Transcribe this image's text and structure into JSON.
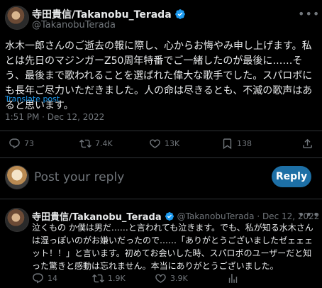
{
  "tweet": {
    "author_name": "寺田貴信/Takanobu_Terada",
    "author_handle": "@TakanobuTerada",
    "text": "水木一郎さんのご逝去の報に際し、心からお悔やみ申し上げます。私とは先日のマジンガーZ50周年特番でご一緒したのが最後に……そう、最後まで歌われることを選ばれた偉大な歌手でした。スパロボにも長年ご尽力いただきました。人の命は尽きるとも、不滅の歌声はあると思います。",
    "translate_label": "Translate post",
    "timestamp": "1:51 PM · Dec 12, 2022",
    "stats": {
      "replies": "73",
      "reposts": "7.4K",
      "likes": "13K",
      "bookmarks": "138"
    }
  },
  "reply_composer": {
    "placeholder": "Post your reply",
    "button_label": "Reply"
  },
  "reply": {
    "author_name": "寺田貴信/Takanobu_Terada",
    "author_handle": "@TakanobuTerada · Dec 12, 2022",
    "text": "泣くもの か僕は男だ……と言われても泣きます。でも、私が知る水木さんは湿っぽいのがお嫌いだったので……「ありがとうございましたゼェェェット！！」と言います。初めてお会いした時、スパロボのユーザーだと知った驚きと感動は忘れません。本当にありがとうございました。",
    "stats": {
      "replies": "14",
      "reposts": "1.9K",
      "likes": "3.9K",
      "views": ""
    }
  },
  "icons": {
    "verified": "verified-badge-icon",
    "more": "more-options-icon",
    "reply": "reply-icon",
    "repost": "repost-icon",
    "like": "heart-icon",
    "bookmark": "bookmark-icon",
    "share": "share-icon",
    "views": "views-icon"
  },
  "colors": {
    "background": "#000000",
    "text": "#e7e9ea",
    "muted": "#71767b",
    "accent": "#1d9bf0",
    "divider": "#2f3336"
  }
}
